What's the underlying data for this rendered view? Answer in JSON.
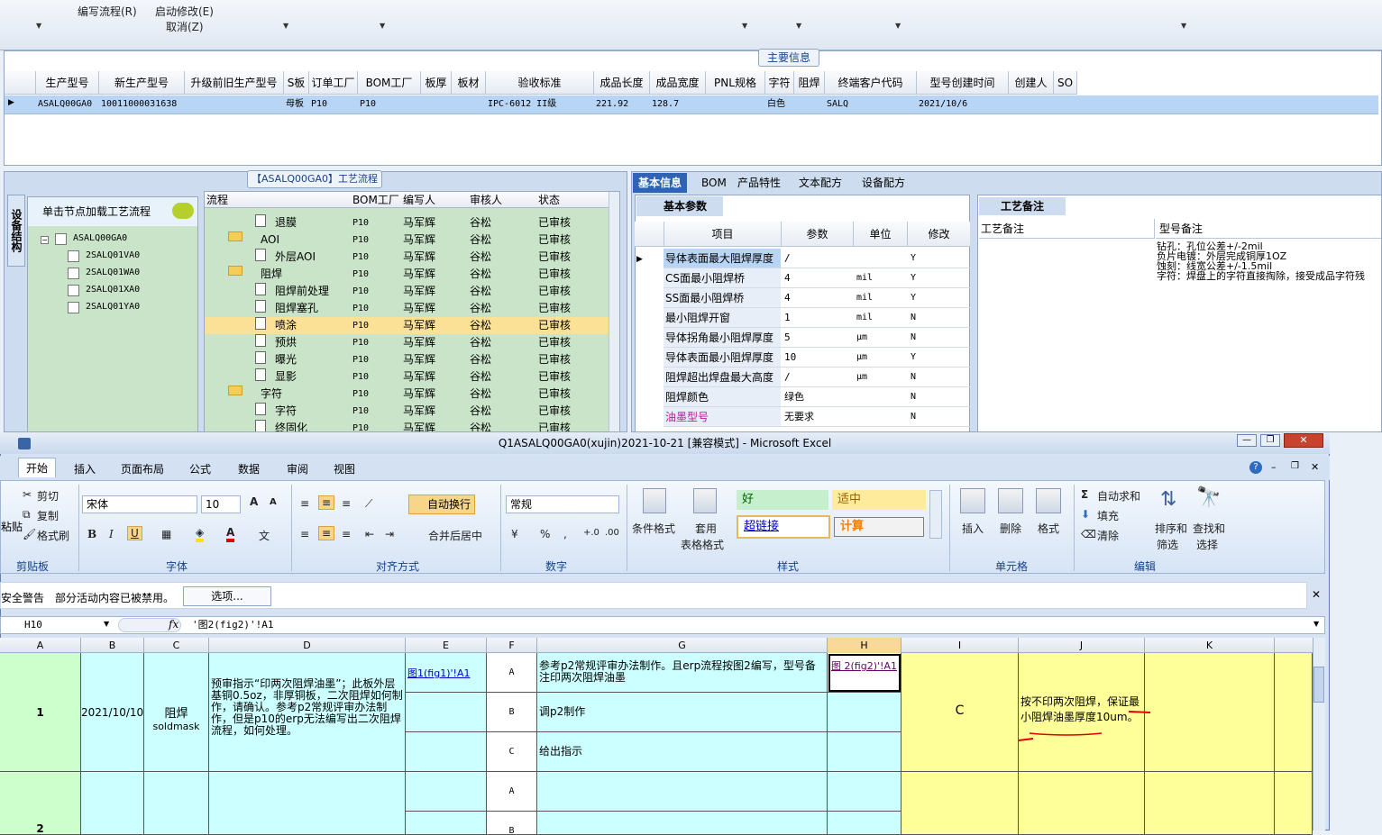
{
  "top_toolbar": {
    "items": [
      {
        "label": "编写流程(R)"
      },
      {
        "label": "启动修改(E)"
      },
      {
        "label": "取消(Z)"
      }
    ]
  },
  "main_info": {
    "title": "主要信息",
    "columns": [
      "生产型号",
      "新生产型号",
      "升级前旧生产型号",
      "S板",
      "订单工厂",
      "BOM工厂",
      "板厚",
      "板材",
      "验收标准",
      "成品长度",
      "成品宽度",
      "PNL规格",
      "字符",
      "阻焊",
      "终端客户代码",
      "型号创建时间",
      "创建人",
      "SO"
    ],
    "row": {
      "c0": "ASALQ00GA0",
      "c1": "10011000031638",
      "c3": "母板",
      "c4": "P10",
      "c5": "P10",
      "c8": "IPC-6012 II级",
      "c9": "221.92",
      "c10": "128.7",
      "c12": "白色",
      "c14": "SALQ",
      "c15": "2021/10/6"
    }
  },
  "process": {
    "title": "【ASALQ00GA0】工艺流程",
    "side_tab": "设备结构",
    "tree_hint": "单击节点加载工艺流程",
    "tree": [
      "ASALQ00GA0",
      "2SALQ01VA0",
      "2SALQ01WA0",
      "2SALQ01XA0",
      "2SALQ01YA0"
    ],
    "columns": [
      "流程",
      "BOM工厂",
      "编写人",
      "审核人",
      "状态"
    ],
    "rows": [
      {
        "name": "退膜",
        "bom": "P10",
        "author": "马军辉",
        "auditor": "谷松",
        "status": "已审核"
      },
      {
        "name": "AOI",
        "bom": "P10",
        "author": "马军辉",
        "auditor": "谷松",
        "status": "已审核"
      },
      {
        "name": "外层AOI",
        "bom": "P10",
        "author": "马军辉",
        "auditor": "谷松",
        "status": "已审核"
      },
      {
        "name": "阻焊",
        "bom": "P10",
        "author": "马军辉",
        "auditor": "谷松",
        "status": "已审核"
      },
      {
        "name": "阻焊前处理",
        "bom": "P10",
        "author": "马军辉",
        "auditor": "谷松",
        "status": "已审核"
      },
      {
        "name": "阻焊塞孔",
        "bom": "P10",
        "author": "马军辉",
        "auditor": "谷松",
        "status": "已审核"
      },
      {
        "name": "喷涂",
        "bom": "P10",
        "author": "马军辉",
        "auditor": "谷松",
        "status": "已审核"
      },
      {
        "name": "预烘",
        "bom": "P10",
        "author": "马军辉",
        "auditor": "谷松",
        "status": "已审核"
      },
      {
        "name": "曝光",
        "bom": "P10",
        "author": "马军辉",
        "auditor": "谷松",
        "status": "已审核"
      },
      {
        "name": "显影",
        "bom": "P10",
        "author": "马军辉",
        "auditor": "谷松",
        "status": "已审核"
      },
      {
        "name": "字符",
        "bom": "P10",
        "author": "马军辉",
        "auditor": "谷松",
        "status": "已审核"
      },
      {
        "name": "字符",
        "bom": "P10",
        "author": "马军辉",
        "auditor": "谷松",
        "status": "已审核"
      },
      {
        "name": "终固化",
        "bom": "P10",
        "author": "马军辉",
        "auditor": "谷松",
        "status": "已审核"
      }
    ]
  },
  "right_tabs": [
    "基本信息",
    "BOM",
    "产品特性",
    "文本配方",
    "设备配方"
  ],
  "basic_params": {
    "title": "基本参数",
    "columns": [
      "项目",
      "参数",
      "单位",
      "修改"
    ],
    "rows": [
      {
        "item": "导体表面最大阻焊厚度",
        "param": "/",
        "unit": "",
        "mod": "Y"
      },
      {
        "item": "CS面最小阻焊桥",
        "param": "4",
        "unit": "mil",
        "mod": "Y"
      },
      {
        "item": "SS面最小阻焊桥",
        "param": "4",
        "unit": "mil",
        "mod": "Y"
      },
      {
        "item": "最小阻焊开窗",
        "param": "1",
        "unit": "mil",
        "mod": "N"
      },
      {
        "item": "导体拐角最小阻焊厚度",
        "param": "5",
        "unit": "μm",
        "mod": "N"
      },
      {
        "item": "导体表面最小阻焊厚度",
        "param": "10",
        "unit": "μm",
        "mod": "Y"
      },
      {
        "item": "阻焊超出焊盘最大高度",
        "param": "/",
        "unit": "μm",
        "mod": "N"
      },
      {
        "item": "阻焊颜色",
        "param": "绿色",
        "unit": "",
        "mod": "N"
      },
      {
        "item": "油墨型号",
        "param": "无要求",
        "unit": "",
        "mod": "N"
      }
    ]
  },
  "process_notes": {
    "title": "工艺备注",
    "col1": "工艺备注",
    "col2": "型号备注",
    "notes": [
      "钻孔：孔位公差+/-2mil",
      "负片电镀：外层完成铜厚1OZ",
      "蚀刻：线宽公差+/-1.5mil",
      "字符：焊盘上的字符直接掏除，接受成品字符残"
    ]
  },
  "excel": {
    "title": "Q1ASALQ00GA0(xujin)2021-10-21 [兼容模式] - Microsoft Excel",
    "tabs": [
      "开始",
      "插入",
      "页面布局",
      "公式",
      "数据",
      "审阅",
      "视图"
    ],
    "clipboard": {
      "cut": "剪切",
      "copy": "复制",
      "format_painter": "格式刷",
      "paste": "粘贴",
      "label": "剪贴板"
    },
    "font": {
      "name": "宋体",
      "size": "10",
      "label": "字体"
    },
    "align": {
      "wrap": "自动换行",
      "merge": "合并后居中",
      "label": "对齐方式"
    },
    "number": {
      "format": "常规",
      "label": "数字"
    },
    "styles": {
      "good": "好",
      "neutral": "适中",
      "hyperlink": "超链接",
      "calc": "计算",
      "cond_format": "条件格式",
      "table_format_1": "套用",
      "table_format_2": "表格格式",
      "label": "样式"
    },
    "cells": {
      "insert": "插入",
      "delete": "删除",
      "format": "格式",
      "label": "单元格"
    },
    "editing": {
      "autosum": "自动求和",
      "fill": "填充",
      "clear": "清除",
      "sort_1": "排序和",
      "sort_2": "筛选",
      "find_1": "查找和",
      "find_2": "选择",
      "label": "编辑"
    },
    "security": {
      "title": "安全警告",
      "msg": "部分活动内容已被禁用。",
      "options": "选项..."
    },
    "namebox": "H10",
    "formula": "'图2(fig2)'!A1",
    "columns": [
      "A",
      "B",
      "C",
      "D",
      "E",
      "F",
      "G",
      "H",
      "I",
      "J",
      "K"
    ],
    "row1": {
      "num": "1",
      "date": "2021/10/10",
      "cat": "阻焊",
      "cat_en": "soldmask",
      "desc": "预审指示“印两次阻焊油墨”；此板外层基铜0.5oz，非厚铜板，二次阻焊如何制作，请确认。参考p2常规评审办法制作，但是p10的erp无法编写出二次阻焊流程，如何处理。",
      "link1": "图1(fig1)'!A1",
      "opts": [
        {
          "k": "A",
          "v": "参考p2常规评审办法制作。且erp流程按图2编写，型号备注印两次阻焊油墨"
        },
        {
          "k": "B",
          "v": "调p2制作"
        },
        {
          "k": "C",
          "v": "给出指示"
        }
      ],
      "link2": "图 2(fig2)'!A1",
      "choice": "C",
      "reply": "按不印两次阻焊，保证最小阻焊油墨厚度10um。"
    },
    "row2": {
      "num": "2",
      "opts": [
        "A",
        "B"
      ]
    }
  }
}
